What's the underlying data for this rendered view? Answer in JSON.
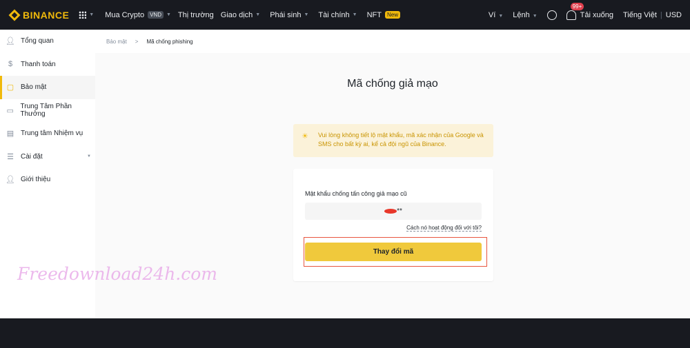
{
  "header": {
    "logo": "BINANCE",
    "nav": [
      {
        "label": "Mua Crypto",
        "badge": "VND"
      },
      {
        "label": "Thị trường"
      },
      {
        "label": "Giao dịch"
      },
      {
        "label": "Phái sinh"
      },
      {
        "label": "Tài chính"
      },
      {
        "label": "NFT",
        "badge": "New"
      }
    ],
    "wallet": "Ví",
    "orders": "Lệnh",
    "notifications": "99+",
    "download": "Tải xuống",
    "language": "Tiếng Việt",
    "currency": "USD"
  },
  "sidebar": {
    "items": [
      {
        "label": "Tổng quan",
        "icon": "user-icon"
      },
      {
        "label": "Thanh toán",
        "icon": "dollar-icon"
      },
      {
        "label": "Bảo mật",
        "icon": "shield-icon",
        "active": true
      },
      {
        "label": "Trung Tâm Phần Thưởng",
        "icon": "ticket-icon"
      },
      {
        "label": "Trung tâm Nhiệm vụ",
        "icon": "clipboard-icon"
      },
      {
        "label": "Cài đặt",
        "icon": "sliders-icon"
      },
      {
        "label": "Giới thiệu",
        "icon": "add-user-icon"
      }
    ]
  },
  "breadcrumb": {
    "parent": "Bảo mật",
    "current": "Mã chống phishing"
  },
  "page": {
    "title": "Mã chống giả mạo",
    "warning": "Vui lòng không tiết lộ mật khẩu, mã xác nhận của Google và SMS cho bất kỳ ai, kể cả đội ngũ của Binance.",
    "field_label": "Mật khẩu chống tấn công giả mạo cũ",
    "field_value": "**",
    "help_link": "Cách nó hoạt động đối với tôi?",
    "button": "Thay đổi mã"
  },
  "watermark": "Freedownload24h.com",
  "colors": {
    "accent": "#f0b90b",
    "highlight": "#e8553e"
  }
}
